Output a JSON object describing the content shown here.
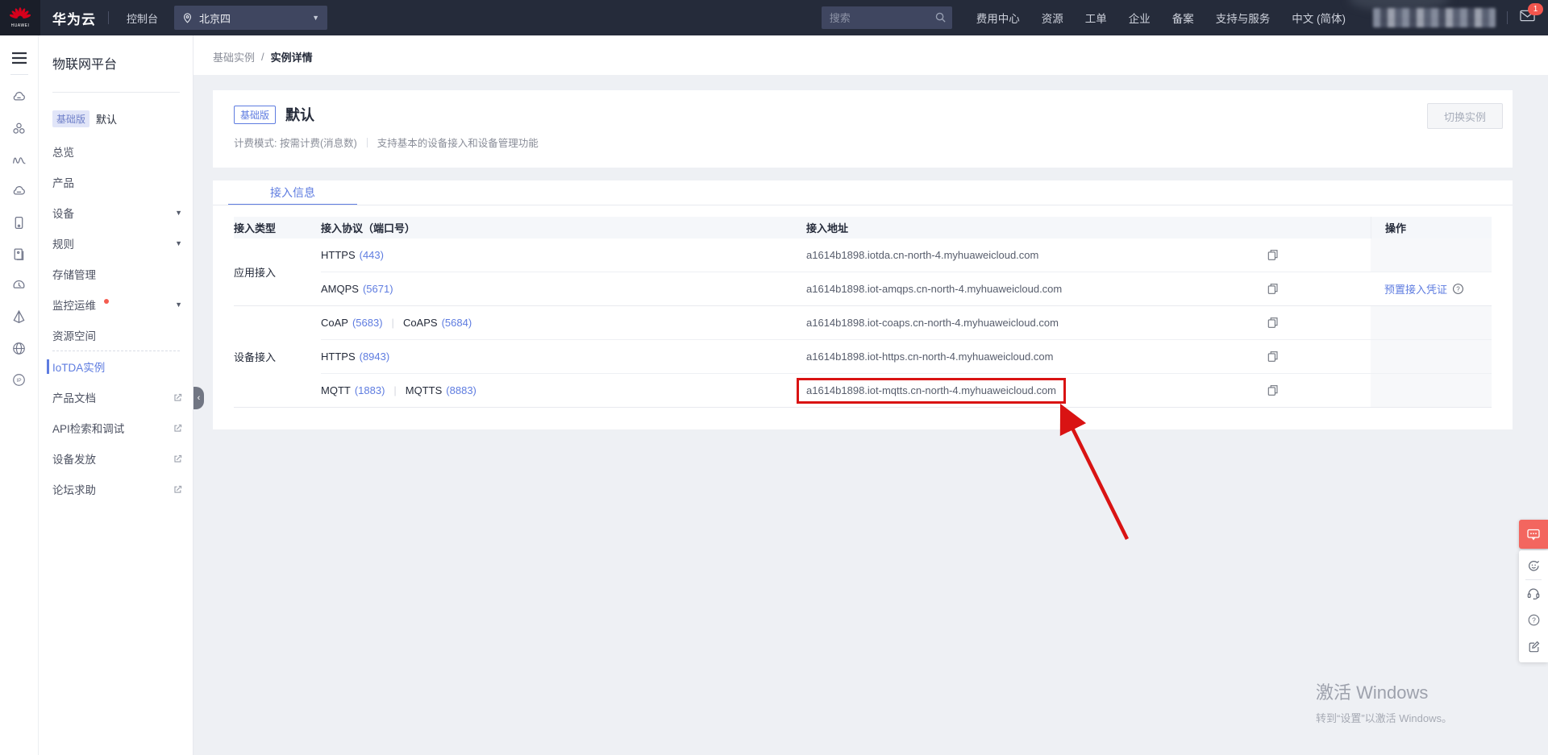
{
  "topbar": {
    "brand": "华为云",
    "console": "控制台",
    "region": "北京四",
    "search_placeholder": "搜索",
    "nav": [
      "费用中心",
      "资源",
      "工单",
      "企业",
      "备案",
      "支持与服务",
      "中文 (简体)"
    ],
    "mail_badge": "1"
  },
  "sidebar": {
    "title": "物联网平台",
    "edition_badge": "基础版",
    "edition_name": "默认",
    "items": [
      {
        "label": "总览"
      },
      {
        "label": "产品"
      },
      {
        "label": "设备"
      },
      {
        "label": "规则"
      },
      {
        "label": "存储管理"
      },
      {
        "label": "监控运维"
      },
      {
        "label": "资源空间"
      },
      {
        "label": "IoTDA实例"
      },
      {
        "label": "产品文档"
      },
      {
        "label": "API检索和调试"
      },
      {
        "label": "设备发放"
      },
      {
        "label": "论坛求助"
      }
    ]
  },
  "breadcrumb": {
    "parent": "基础实例",
    "separator": "/",
    "current": "实例详情"
  },
  "instance": {
    "badge": "基础版",
    "name": "默认",
    "billing": "计费模式: 按需计费(消息数)",
    "description": "支持基本的设备接入和设备管理功能",
    "switch_button": "切换实例"
  },
  "access": {
    "tab": "接入信息",
    "col_type": "接入类型",
    "col_protocol": "接入协议（端口号）",
    "col_address": "接入地址",
    "col_action": "操作",
    "sep": "|",
    "credential_link": "预置接入凭证",
    "groups": [
      {
        "type": "应用接入",
        "rows": [
          {
            "p1": "HTTPS",
            "port1": "(443)",
            "address": "a1614b1898.iotda.cn-north-4.myhuaweicloud.com"
          },
          {
            "p1": "AMQPS",
            "port1": "(5671)",
            "address": "a1614b1898.iot-amqps.cn-north-4.myhuaweicloud.com"
          }
        ]
      },
      {
        "type": "设备接入",
        "rows": [
          {
            "p1": "CoAP",
            "port1": "(5683)",
            "p2": "CoAPS",
            "port2": "(5684)",
            "address": "a1614b1898.iot-coaps.cn-north-4.myhuaweicloud.com"
          },
          {
            "p1": "HTTPS",
            "port1": "(8943)",
            "address": "a1614b1898.iot-https.cn-north-4.myhuaweicloud.com"
          },
          {
            "p1": "MQTT",
            "port1": "(1883)",
            "p2": "MQTTS",
            "port2": "(8883)",
            "address": "a1614b1898.iot-mqtts.cn-north-4.myhuaweicloud.com"
          }
        ]
      }
    ]
  },
  "watermark": {
    "line1": "激活 Windows",
    "line2": "转到“设置”以激活 Windows。"
  },
  "colors": {
    "accent": "#5e7ce0",
    "topbar_bg": "#252b3a",
    "annotation_red": "#d91313",
    "alert_dot": "#f45c50",
    "float_red": "#f3665f"
  },
  "icons": {
    "topbar": [
      "huawei-logo",
      "location-pin-icon",
      "caret-down-icon",
      "search-icon",
      "mail-icon"
    ],
    "rail": [
      "menu-icon",
      "cloud-icon",
      "organization-icon",
      "waves-icon",
      "cloud-server-icon",
      "device-icon",
      "document-icon",
      "clock-icon",
      "prism-icon",
      "globe-icon",
      "ip-icon"
    ],
    "sidebar": [
      "chevron-down-icon",
      "red-dot",
      "external-link-icon",
      "collapse-arrow-icon"
    ],
    "table": [
      "copy-icon",
      "help-circle-icon"
    ],
    "annotation": [
      "red-box",
      "red-arrow"
    ],
    "float_toolbar": [
      "chat-icon",
      "feedback-smiley-icon",
      "headset-icon",
      "question-icon",
      "survey-icon"
    ]
  }
}
